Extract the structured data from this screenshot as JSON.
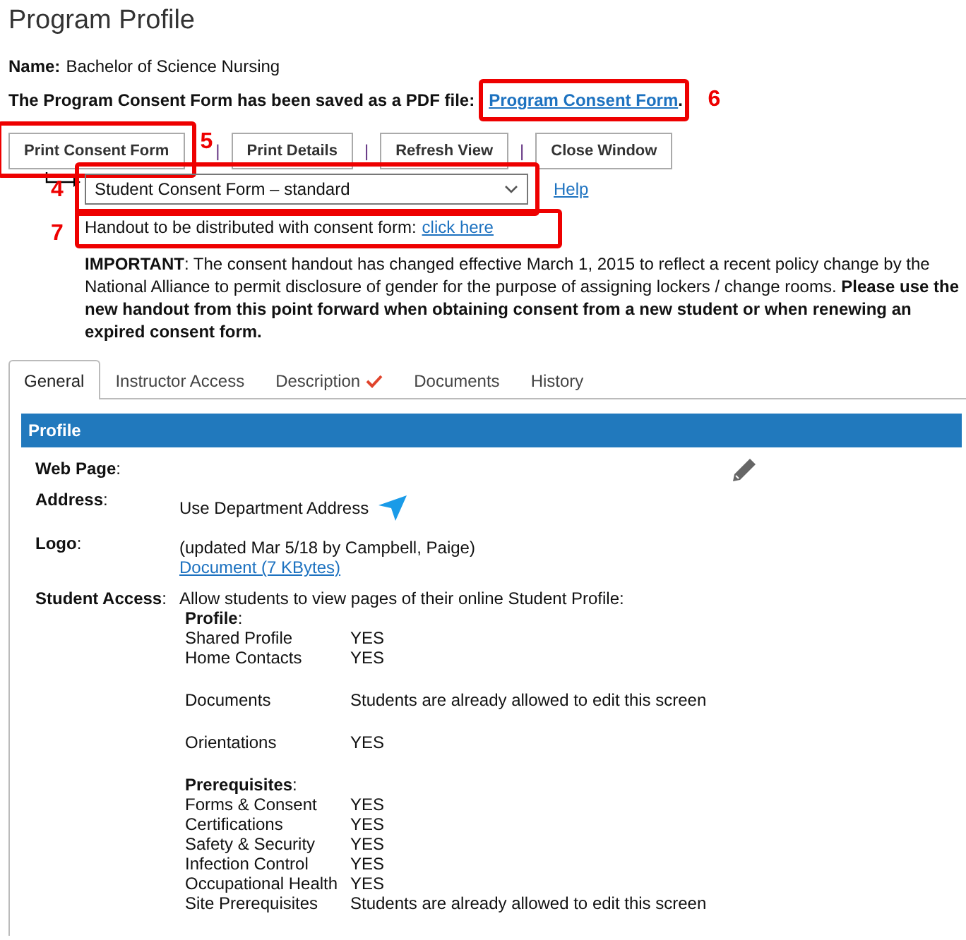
{
  "title": "Program Profile",
  "name": {
    "label": "Name:",
    "value": "Bachelor of Science Nursing"
  },
  "pdf_notice": {
    "text": "The Program Consent Form has been saved as a PDF file:",
    "link": "Program Consent Form",
    "after": ".",
    "callout": "6"
  },
  "buttons": [
    {
      "label": "Print Consent Form",
      "callout": "5"
    },
    {
      "label": "Print Details"
    },
    {
      "label": "Refresh View"
    },
    {
      "label": "Close Window"
    }
  ],
  "separator": "|",
  "consent_select": {
    "value": "Student Consent Form – standard",
    "callout": "4",
    "help": "Help"
  },
  "handout": {
    "text": "Handout to be distributed with consent form:",
    "link": "click here",
    "callout": "7"
  },
  "important": "**IMPORTANT**: The consent handout has changed effective March 1, 2015 to reflect a recent policy change by the National Alliance to permit disclosure of gender for the purpose of assigning lockers / change rooms. **Please use the new handout from this point forward when obtaining consent from a new student or when renewing an expired consent form.**",
  "tabs": [
    {
      "label": "General",
      "selected": true,
      "checked": false
    },
    {
      "label": "Instructor Access",
      "selected": false,
      "checked": false
    },
    {
      "label": "Description",
      "selected": false,
      "checked": true
    },
    {
      "label": "Documents",
      "selected": false,
      "checked": false
    },
    {
      "label": "History",
      "selected": false,
      "checked": false
    }
  ],
  "section_title": "Profile",
  "fields": [
    {
      "label": "**Web Page**:"
    },
    {
      "label": "**Address**:",
      "lines": [
        "Use Department Address"
      ],
      "kind": "address"
    },
    {
      "label": "**Logo**:",
      "lines": [
        "(updated Mar 5/18 by Campbell, Paige)"
      ],
      "link": "Document (7 KBytes)"
    }
  ],
  "student_access": {
    "label": "**Student Access**:",
    "intro": "Allow students to view pages of their online Student Profile:",
    "groups": [
      {
        "heading": "**Profile**:",
        "rows": [
          {
            "name": "Shared Profile",
            "value": "YES"
          },
          {
            "name": "Home Contacts",
            "value": "YES"
          }
        ]
      },
      {
        "rows": [
          {
            "name": "Documents",
            "value": "Students are already allowed to edit this screen"
          }
        ]
      },
      {
        "rows": [
          {
            "name": "Orientations",
            "value": "YES"
          }
        ]
      },
      {
        "heading": "**Prerequisites**:",
        "rows": [
          {
            "name": "Forms & Consent",
            "value": "YES"
          },
          {
            "name": "Certifications",
            "value": "YES"
          },
          {
            "name": "Safety & Security",
            "value": "YES"
          },
          {
            "name": "Infection Control",
            "value": "YES"
          },
          {
            "name": "Occupational Health",
            "value": "YES"
          },
          {
            "name": "Site Prerequisites",
            "value": "Students are already allowed to edit this screen"
          }
        ]
      }
    ]
  }
}
